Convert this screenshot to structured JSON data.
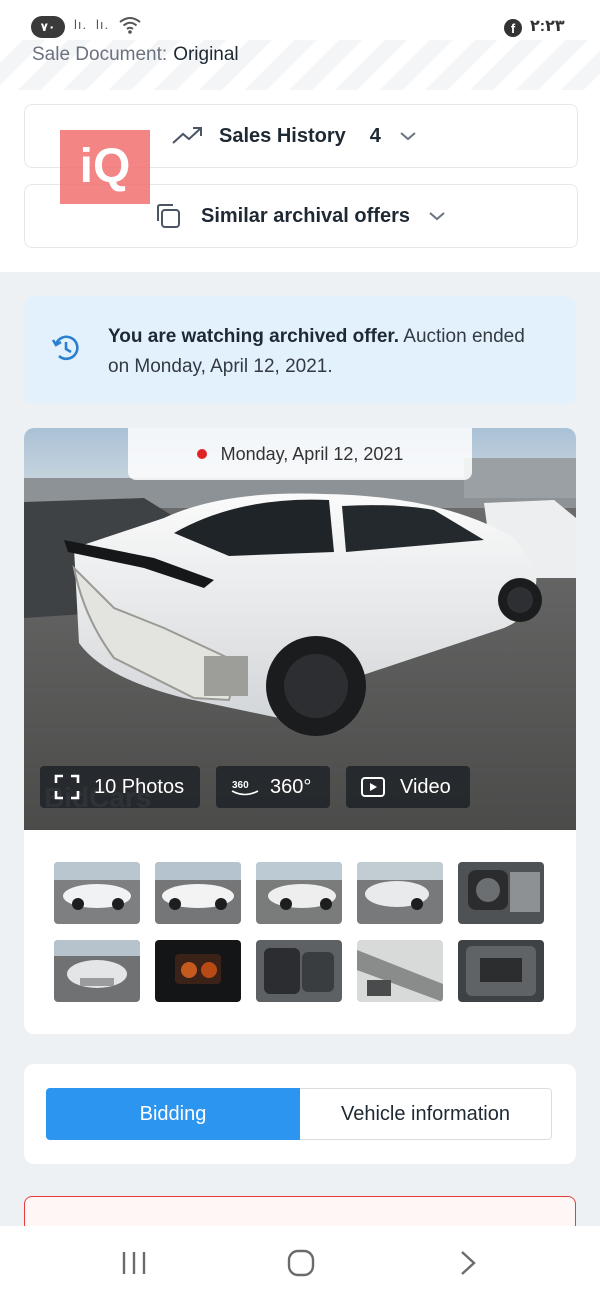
{
  "status_bar": {
    "badge": "٧٠",
    "signal_1": "lı.",
    "signal_2": "lı.",
    "wifi_icon": "wifi-icon",
    "app_icon": "facebook-icon",
    "clock": "٢:٢٣"
  },
  "sale_document": {
    "label": "Sale Document:",
    "value": "Original"
  },
  "sales_history": {
    "label": "Sales History",
    "count": "4"
  },
  "similar_offers": {
    "label": "Similar archival offers"
  },
  "notice": {
    "bold": "You are watching archived offer.",
    "text": " Auction ended on Monday, April 12, 2021."
  },
  "photo": {
    "date": "Monday, April 12, 2021",
    "photos_label": "10 Photos",
    "pano_label": "360°",
    "video_label": "Video",
    "watermark": "BidCars"
  },
  "thumbnails_count": 10,
  "tabs": {
    "active": "Bidding",
    "inactive": "Vehicle information"
  },
  "logo_text": "iQ",
  "colors": {
    "accent": "#2b95f0",
    "notice_bg": "#e3f1fd",
    "alert": "#e53e3e"
  }
}
